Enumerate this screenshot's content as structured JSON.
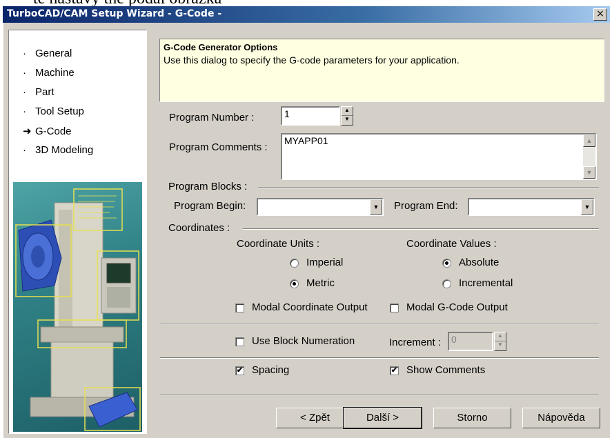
{
  "top_text": "te nastavy the podal obrazka",
  "window": {
    "title": "TurboCAD/CAM Setup Wizard - G-Code -",
    "close": "×"
  },
  "nav": {
    "items": [
      {
        "bullet": "·",
        "label": "General"
      },
      {
        "bullet": "·",
        "label": "Machine"
      },
      {
        "bullet": "·",
        "label": "Part"
      },
      {
        "bullet": "·",
        "label": "Tool Setup"
      },
      {
        "bullet": "➜",
        "label": "G-Code"
      },
      {
        "bullet": "·",
        "label": "3D Modeling"
      }
    ]
  },
  "info": {
    "heading": "G-Code Generator Options",
    "description": "Use this dialog to specify the G-code parameters for your application."
  },
  "program_number": {
    "label": "Program Number :",
    "value": "1"
  },
  "program_comments": {
    "label": "Program Comments :",
    "value": "MYAPP01"
  },
  "program_blocks": {
    "label": "Program Blocks :",
    "begin_label": "Program Begin:",
    "begin_value": "",
    "end_label": "Program End:",
    "end_value": ""
  },
  "coordinates": {
    "label": "Coordinates :",
    "units_label": "Coordinate Units :",
    "values_label": "Coordinate Values :",
    "imperial": "Imperial",
    "metric": "Metric",
    "absolute": "Absolute",
    "incremental": "Incremental",
    "modal_coord": "Modal Coordinate Output",
    "modal_gcode": "Modal G-Code Output"
  },
  "numeration": {
    "label": "Use Block Numeration",
    "increment_label": "Increment :",
    "increment_value": "0"
  },
  "options": {
    "spacing": "Spacing",
    "show_comments": "Show Comments",
    "check_mark": "✔"
  },
  "buttons": {
    "back": "< Zpět",
    "next": "Další >",
    "cancel": "Storno",
    "help": "Nápověda"
  },
  "icons": {
    "spin_up": "▲",
    "spin_down": "▼",
    "dropdown": "▼"
  }
}
